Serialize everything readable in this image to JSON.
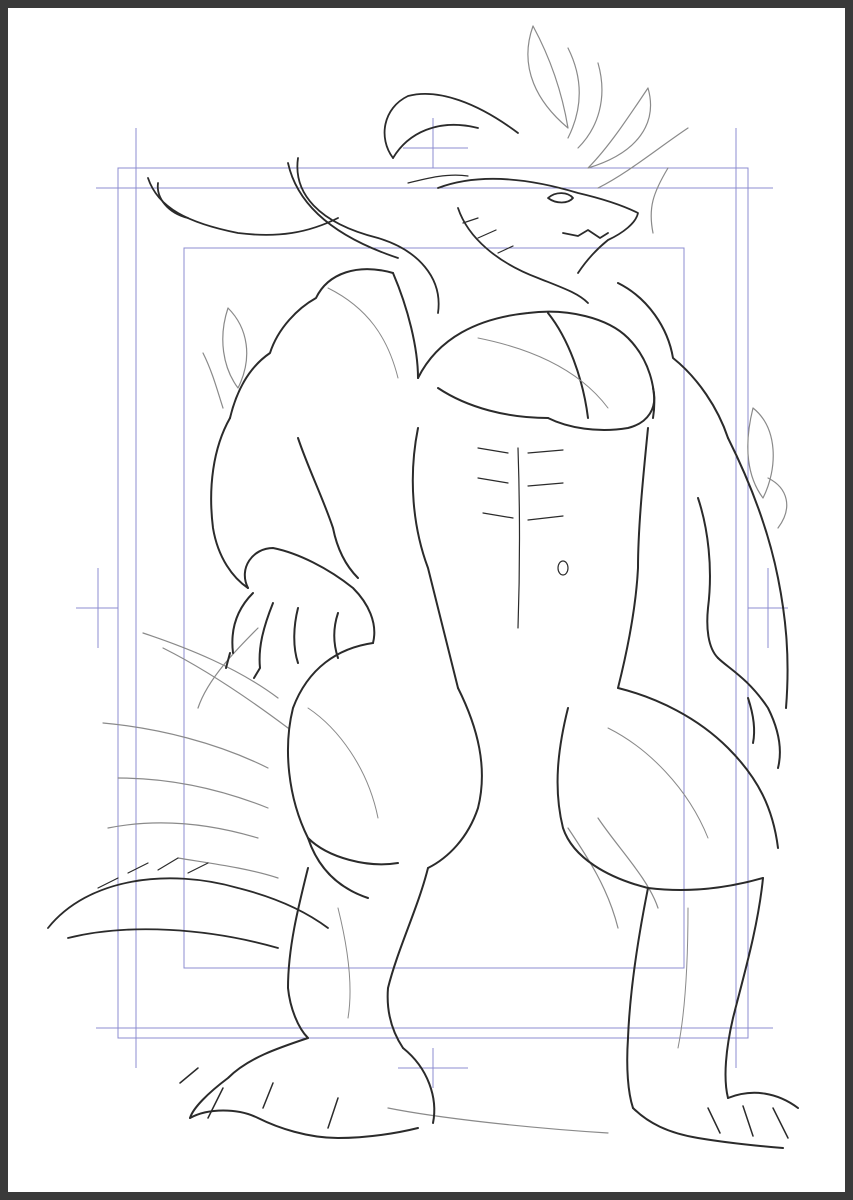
{
  "artwork": {
    "subject": "dragon-sketch",
    "medium": "pencil",
    "line_color": "#2b2b2b",
    "light_line_color": "#8a8a8a",
    "guide_color": "#8c8cd0",
    "frame_color": "#3a3a3a",
    "paper_color": "#ffffff"
  }
}
